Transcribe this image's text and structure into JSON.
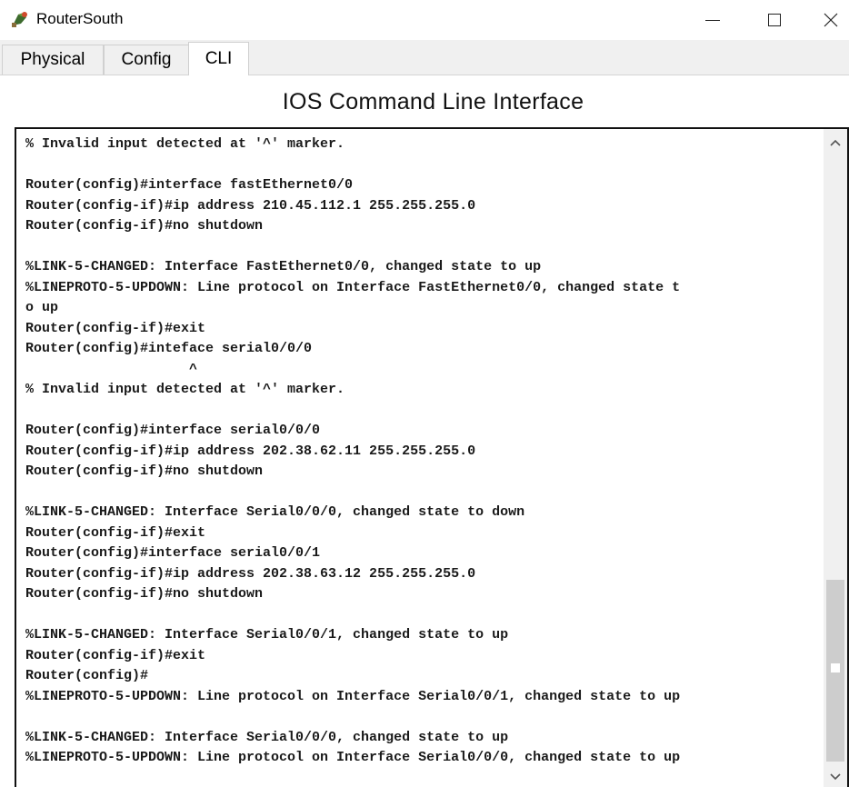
{
  "window": {
    "title": "RouterSouth",
    "icon": "router-app-icon",
    "controls": [
      "minimize",
      "maximize",
      "close"
    ]
  },
  "tabs": [
    {
      "label": "Physical",
      "active": false
    },
    {
      "label": "Config",
      "active": false
    },
    {
      "label": "CLI",
      "active": true
    }
  ],
  "heading": "IOS Command Line Interface",
  "console": {
    "lines": [
      "% Invalid input detected at '^' marker.",
      "",
      "Router(config)#interface fastEthernet0/0",
      "Router(config-if)#ip address 210.45.112.1 255.255.255.0",
      "Router(config-if)#no shutdown",
      "",
      "%LINK-5-CHANGED: Interface FastEthernet0/0, changed state to up",
      "%LINEPROTO-5-UPDOWN: Line protocol on Interface FastEthernet0/0, changed state t",
      "o up",
      "Router(config-if)#exit",
      "Router(config)#inteface serial0/0/0",
      "                    ^",
      "% Invalid input detected at '^' marker.",
      "",
      "Router(config)#interface serial0/0/0",
      "Router(config-if)#ip address 202.38.62.11 255.255.255.0",
      "Router(config-if)#no shutdown",
      "",
      "%LINK-5-CHANGED: Interface Serial0/0/0, changed state to down",
      "Router(config-if)#exit",
      "Router(config)#interface serial0/0/1",
      "Router(config-if)#ip address 202.38.63.12 255.255.255.0",
      "Router(config-if)#no shutdown",
      "",
      "%LINK-5-CHANGED: Interface Serial0/0/1, changed state to up",
      "Router(config-if)#exit",
      "Router(config)#",
      "%LINEPROTO-5-UPDOWN: Line protocol on Interface Serial0/0/1, changed state to up",
      "",
      "%LINK-5-CHANGED: Interface Serial0/0/0, changed state to up",
      "%LINEPROTO-5-UPDOWN: Line protocol on Interface Serial0/0/0, changed state to up"
    ]
  },
  "scrollbar": {
    "position": "bottom",
    "up_icon": "chevron-up-icon",
    "down_icon": "chevron-down-icon"
  },
  "colors": {
    "console_text": "#1a1a1a",
    "tabbar_bg": "#f0f0f0",
    "terminal_border": "#111111"
  }
}
